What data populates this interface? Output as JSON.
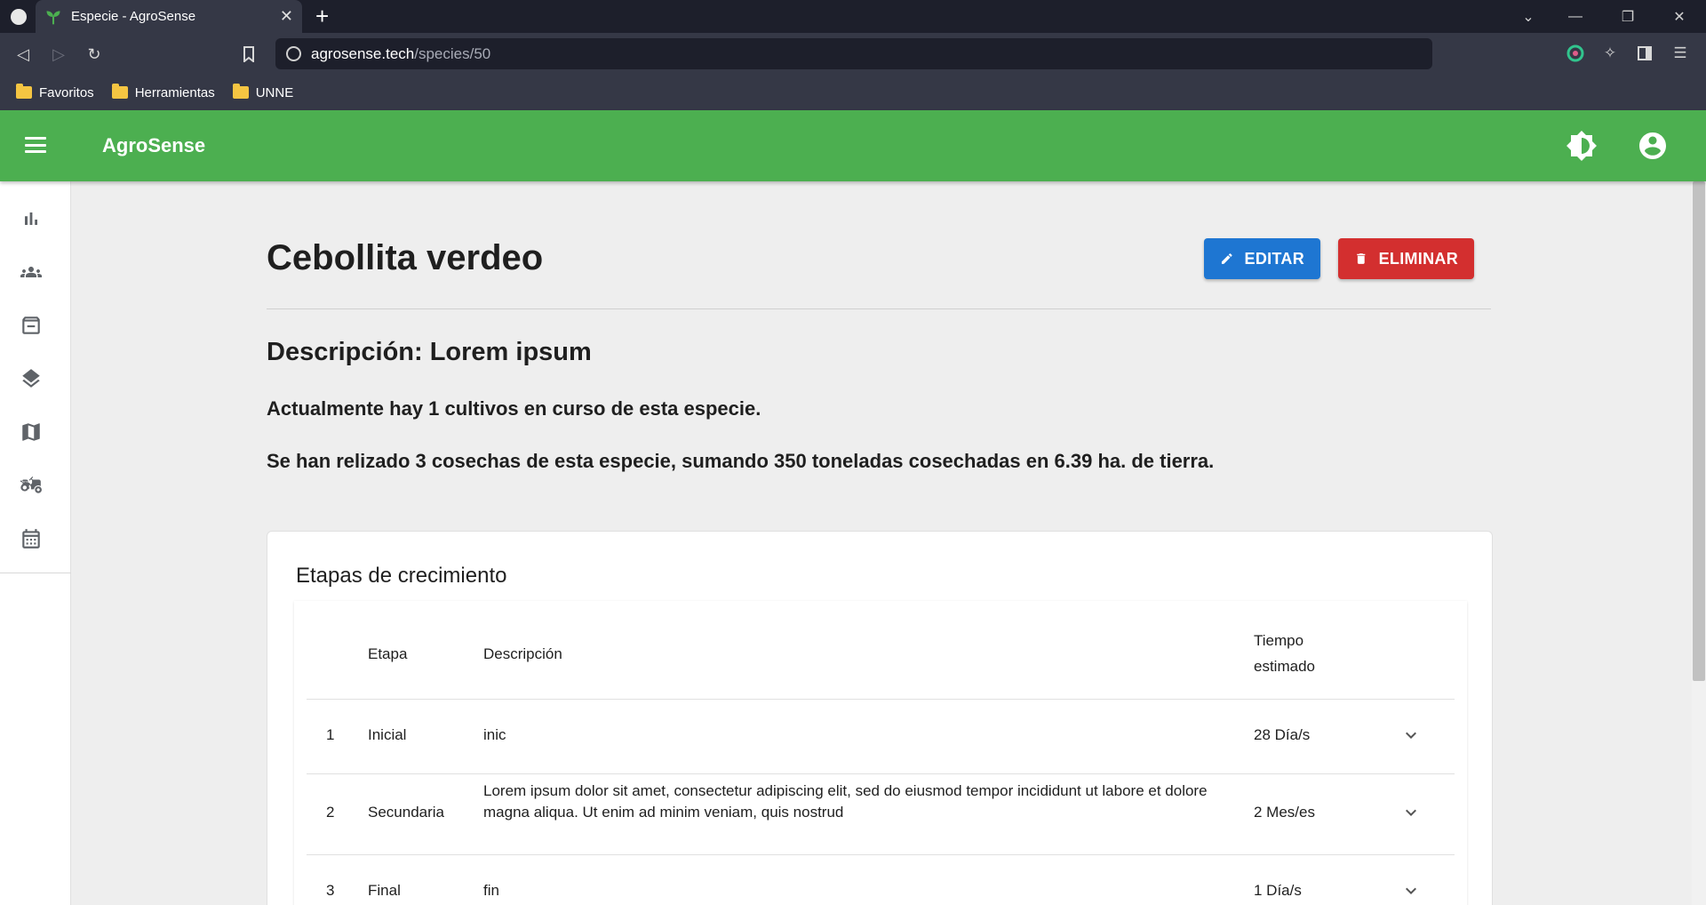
{
  "browser": {
    "tab_title": "Especie - AgroSense",
    "url_host": "agrosense.tech",
    "url_path": "/species/50",
    "bookmarks": [
      "Favoritos",
      "Herramientas",
      "UNNE"
    ]
  },
  "appbar": {
    "title": "AgroSense",
    "color": "#4caf50"
  },
  "sidebar": {
    "items": [
      "bar-chart-icon",
      "groups-icon",
      "archive-icon",
      "layers-icon",
      "map-icon",
      "tractor-icon",
      "calendar-icon"
    ]
  },
  "species": {
    "name": "Cebollita verdeo",
    "description": "Descripción: Lorem ipsum",
    "active_crops_text": "Actualmente hay 1 cultivos en curso de esta especie.",
    "harvest_text": "Se han relizado 3 cosechas de esta especie, sumando 350 toneladas cosechadas en 6.39 ha. de tierra."
  },
  "actions": {
    "edit_label": "EDITAR",
    "delete_label": "ELIMINAR",
    "edit_color": "#1e76d2",
    "delete_color": "#d32f2f"
  },
  "stages": {
    "title": "Etapas de crecimiento",
    "headers": {
      "stage": "Etapa",
      "description": "Descripción",
      "time_line1": "Tiempo",
      "time_line2": "estimado"
    },
    "rows": [
      {
        "num": "1",
        "stage": "Inicial",
        "description": "inic",
        "time": "28 Día/s"
      },
      {
        "num": "2",
        "stage": "Secundaria",
        "description": "Lorem ipsum dolor sit amet, consectetur adipiscing elit, sed do eiusmod tempor incididunt ut labore et dolore magna aliqua. Ut enim ad minim veniam, quis nostrud",
        "time": "2 Mes/es"
      },
      {
        "num": "3",
        "stage": "Final",
        "description": "fin",
        "time": "1 Día/s"
      }
    ]
  }
}
